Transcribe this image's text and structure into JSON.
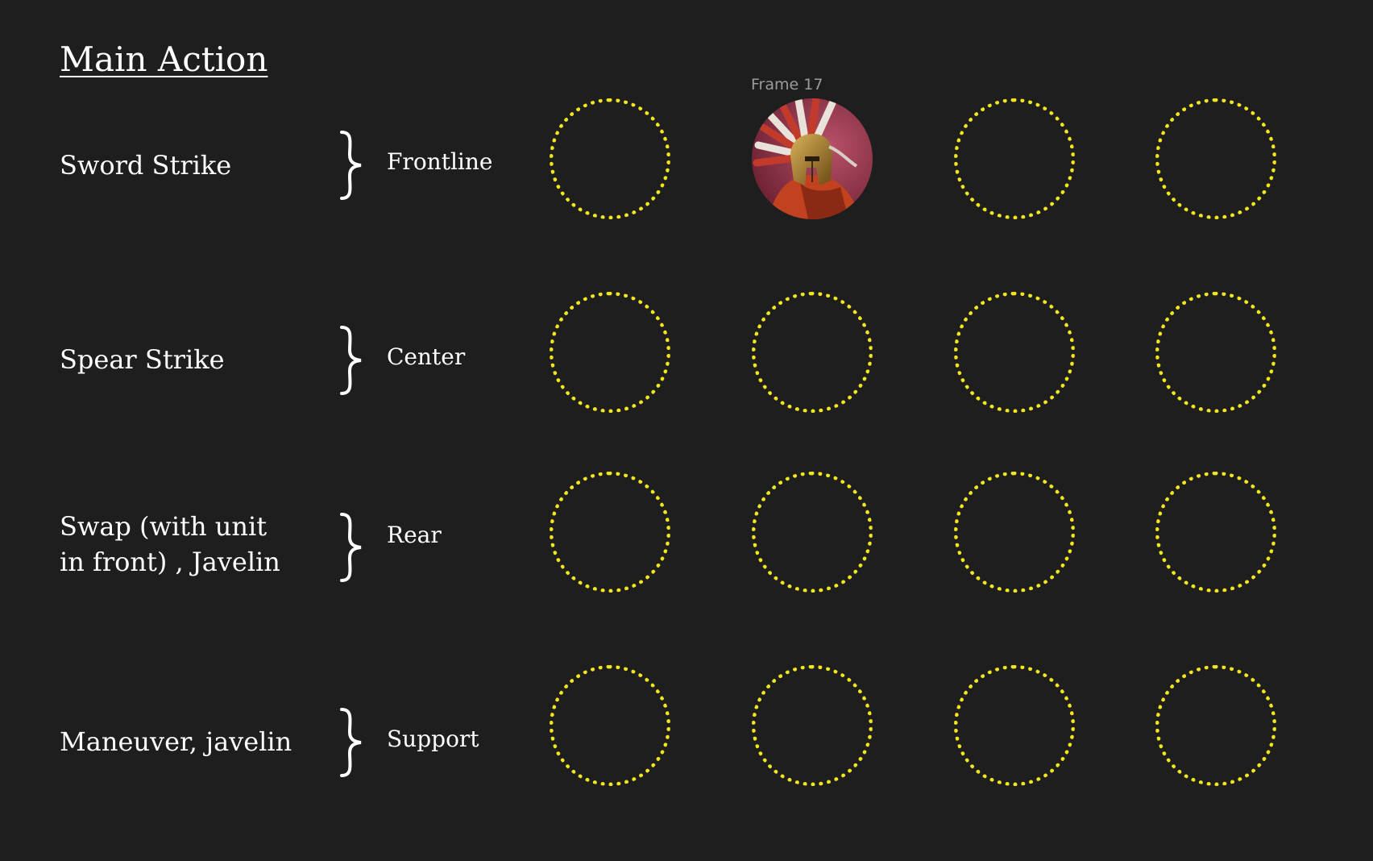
{
  "title": "Main Action",
  "frame_label": "Frame 17",
  "accent_color": "#f2e61c",
  "rows": [
    {
      "action": "Sword Strike",
      "position": "Frontline",
      "slots": [
        "empty",
        "portrait",
        "empty",
        "empty"
      ]
    },
    {
      "action": "Spear Strike",
      "position": "Center",
      "slots": [
        "empty",
        "empty",
        "empty",
        "empty"
      ]
    },
    {
      "action_line1": "Swap (with unit",
      "action_line2": "in front) , Javelin",
      "position": "Rear",
      "slots": [
        "empty",
        "empty",
        "empty",
        "empty"
      ]
    },
    {
      "action": "Maneuver, javelin",
      "position": "Support",
      "slots": [
        "empty",
        "empty",
        "empty",
        "empty"
      ]
    }
  ],
  "portrait": {
    "icon": "spartan-hoplite-portrait"
  }
}
